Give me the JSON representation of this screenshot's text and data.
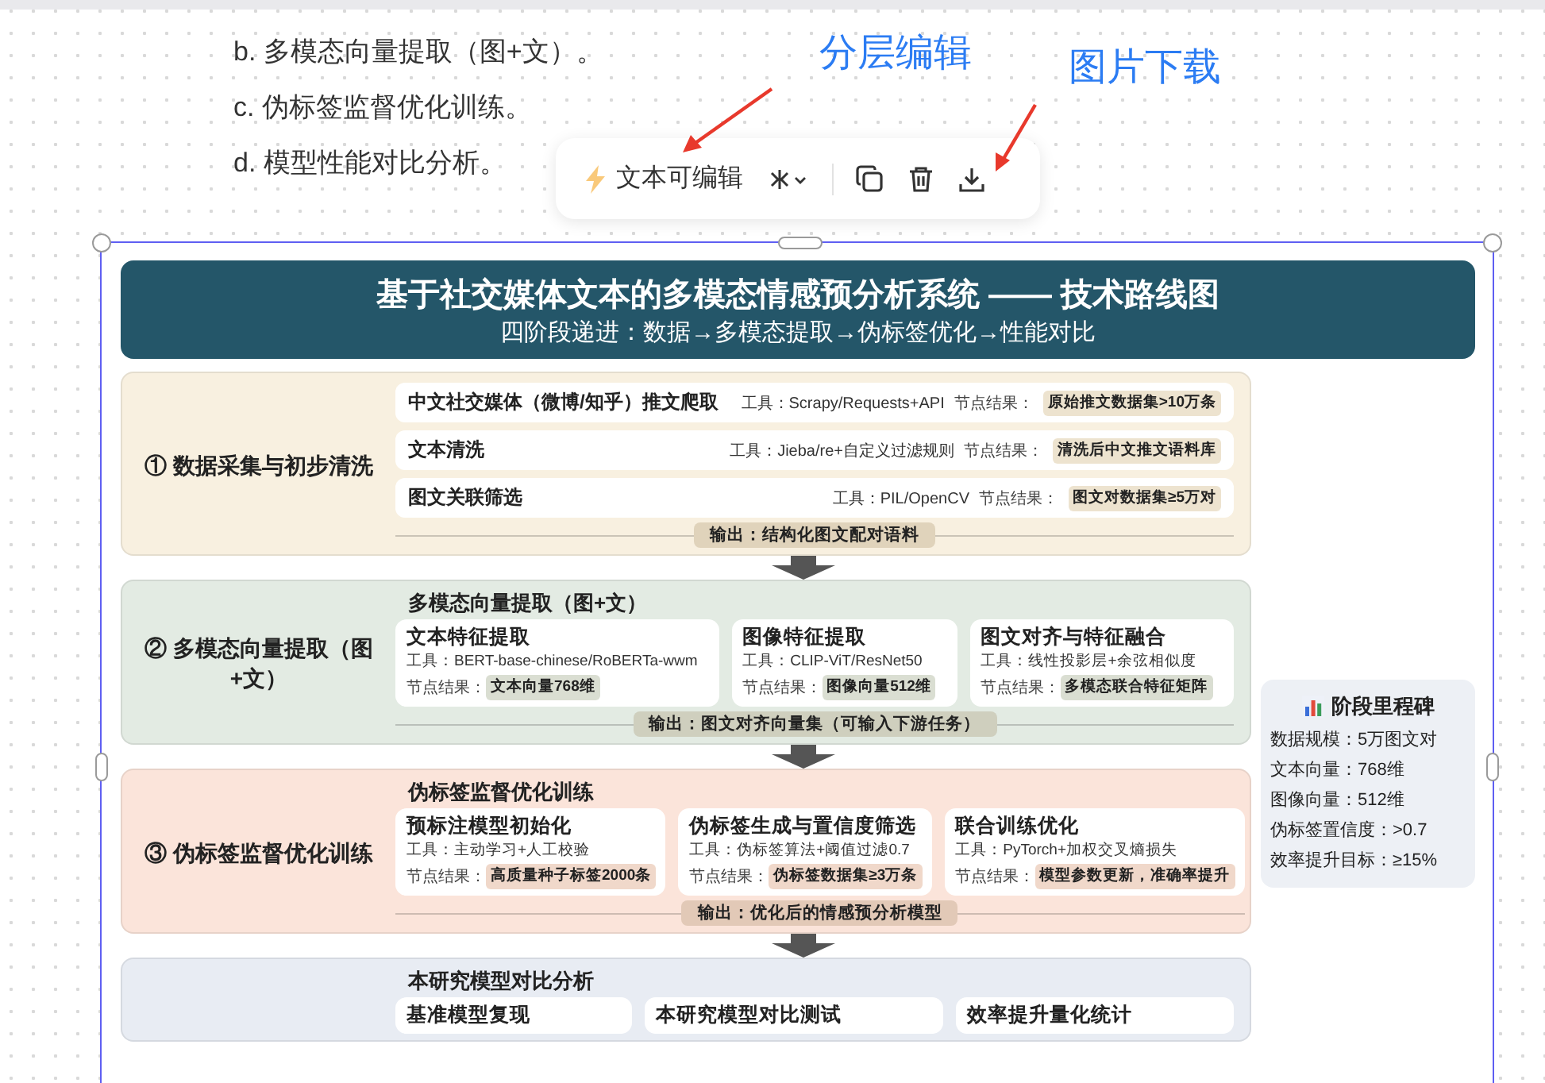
{
  "document_list": [
    "b. 多模态向量提取（图+文）。",
    "c. 伪标签监督优化训练。",
    "d. 模型性能对比分析。"
  ],
  "annotations": [
    {
      "text": "分层编辑"
    },
    {
      "text": "图片下载"
    }
  ],
  "toolbar": {
    "label": "文本可编辑"
  },
  "diagram": {
    "title": "基于社交媒体文本的多模态情感预分析系统 —— 技术路线图",
    "subtitle": "四阶段递进：数据→多模态提取→伪标签优化→性能对比",
    "stages": [
      {
        "kind": "rows",
        "label": "① 数据采集与初步清洗",
        "color": "#f8f0e0",
        "items": [
          {
            "name": "中文社交媒体（微博/知乎）推文爬取",
            "tool": "工具：Scrapy/Requests+API",
            "result_label": "节点结果：",
            "result": "原始推文数据集>10万条"
          },
          {
            "name": "文本清洗",
            "tool": "工具：Jieba/re+自定义过滤规则",
            "result_label": "节点结果：",
            "result": "清洗后中文推文语料库"
          },
          {
            "name": "图文关联筛选",
            "tool": "工具：PIL/OpenCV",
            "result_label": "节点结果：",
            "result": "图文对数据集≥5万对"
          }
        ],
        "output": "输出：结构化图文配对语料"
      },
      {
        "kind": "cards",
        "label": "② 多模态向量提取（图+文）",
        "heading": "多模态向量提取（图+文）",
        "color": "#e3ebe3",
        "items": [
          {
            "name": "文本特征提取",
            "tool": "工具：BERT-base-chinese/RoBERTa-wwm",
            "result_label": "节点结果：",
            "result": "文本向量768维"
          },
          {
            "name": "图像特征提取",
            "tool": "工具：CLIP-ViT/ResNet50",
            "result_label": "节点结果：",
            "result": "图像向量512维"
          },
          {
            "name": "图文对齐与特征融合",
            "tool": "工具：线性投影层+余弦相似度",
            "result_label": "节点结果：",
            "result": "多模态联合特征矩阵"
          }
        ],
        "output": "输出：图文对齐向量集（可输入下游任务）"
      },
      {
        "kind": "cards",
        "label": "③ 伪标签监督优化训练",
        "heading": "伪标签监督优化训练",
        "color": "#fbe4da",
        "items": [
          {
            "name": "预标注模型初始化",
            "tool": "工具：主动学习+人工校验",
            "result_label": "节点结果：",
            "result": "高质量种子标签2000条"
          },
          {
            "name": "伪标签生成与置信度筛选",
            "tool": "工具：伪标签算法+阈值过滤0.7",
            "result_label": "节点结果：",
            "result": "伪标签数据集≥3万条"
          },
          {
            "name": "联合训练优化",
            "tool": "工具：PyTorch+加权交叉熵损失",
            "result_label": "节点结果：",
            "result": "模型参数更新，准确率提升"
          }
        ],
        "output": "输出：优化后的情感预分析模型"
      },
      {
        "kind": "cards",
        "heading": "本研究模型对比分析",
        "color": "#e8ecf3",
        "items": [
          {
            "name": "基准模型复现"
          },
          {
            "name": "本研究模型对比测试"
          },
          {
            "name": "效率提升量化统计"
          }
        ]
      }
    ],
    "milestone": {
      "title": "阶段里程碑",
      "items": [
        "数据规模：5万图文对",
        "文本向量：768维",
        "图像向量：512维",
        "伪标签置信度：>0.7",
        "效率提升目标：≥15%"
      ]
    }
  }
}
